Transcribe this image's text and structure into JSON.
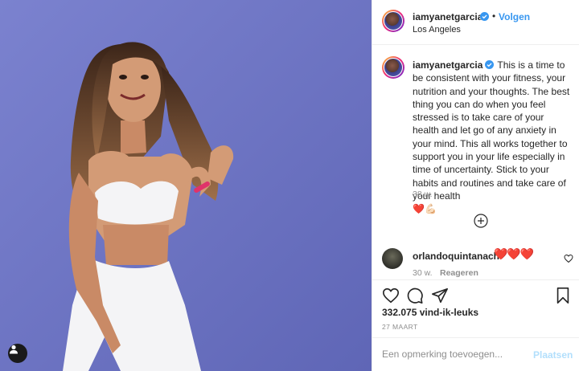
{
  "post": {
    "photo": {
      "description_icon": "user-silhouette-icon",
      "background_color": "#6e78c8"
    },
    "header": {
      "username": "iamyanetgarcia",
      "separator": "•",
      "follow_label": "Volgen",
      "location": "Los Angeles"
    },
    "caption": {
      "username": "iamyanetgarcia",
      "text": "This is a time to be consistent with your fitness, your nutrition and your thoughts. The best thing you can do when you feel stressed is to take care of your health and let go of any anxiety in your mind. This all works together to support you in your life especially in time of uncertainty. Stick to your habits and routines and take care of your health",
      "emojis": "❤️💪🏻",
      "time": "38 w."
    },
    "comments": [
      {
        "username": "orlandoquintanach",
        "text": "❤️❤️❤️",
        "time": "30 w.",
        "reply_label": "Reageren"
      }
    ],
    "actions": {
      "likes": "332.075 vind-ik-leuks",
      "date": "27 MAART"
    },
    "add_comment": {
      "placeholder": "Een opmerking toevoegen...",
      "post_label": "Plaatsen"
    },
    "colors": {
      "accent": "#3897f0",
      "post_disabled": "#b2dffc",
      "heart": "#e0245e",
      "muted": "#8e8e8e"
    }
  }
}
